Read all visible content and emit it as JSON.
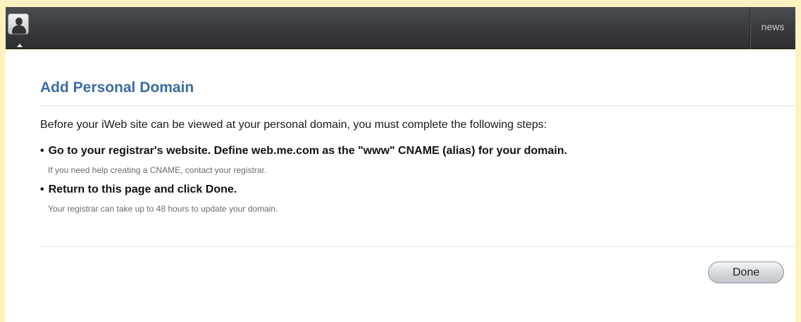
{
  "toolbar": {
    "avatar_icon": "user-silhouette-icon",
    "news_label": "news"
  },
  "dialog": {
    "title": "Add Personal Domain",
    "intro": "Before your iWeb site can be viewed at your personal domain, you must complete the following steps:",
    "steps": [
      {
        "bullet": "•",
        "text": "Go to your registrar's website. Define web.me.com as the \"www\" CNAME (alias) for your domain.",
        "note": "If you need help creating a CNAME, contact your registrar."
      },
      {
        "bullet": "•",
        "text": "Return to this page and click Done.",
        "note": "Your registrar can take up to 48 hours to update your domain."
      }
    ],
    "done_label": "Done"
  },
  "colors": {
    "title": "#3b6da2",
    "toolbar": "#3a3c40",
    "backdrop": "#fdf2c0"
  }
}
